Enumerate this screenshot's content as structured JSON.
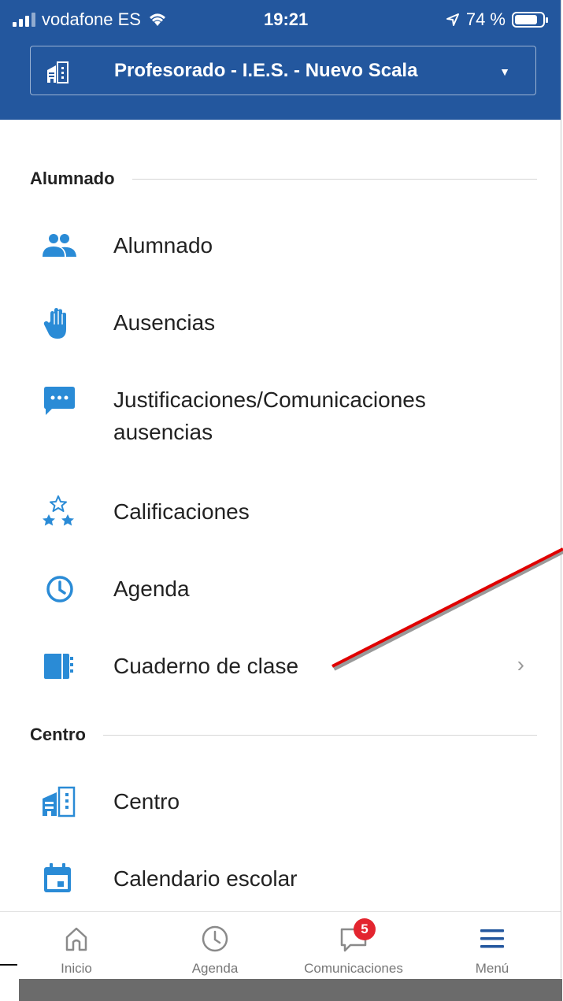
{
  "status_bar": {
    "carrier": "vodafone ES",
    "time": "19:21",
    "battery": "74 %",
    "battery_level": 0.74
  },
  "header": {
    "selector_label": "Profesorado - I.E.S. - Nuevo Scala"
  },
  "sections": {
    "alumnado": "Alumnado",
    "centro": "Centro"
  },
  "items": [
    {
      "label": "Alumnado",
      "icon": "users-icon"
    },
    {
      "label": "Ausencias",
      "icon": "hand-icon"
    },
    {
      "label": "Justificaciones/Comunicaciones",
      "label2": "ausencias",
      "icon": "chat-bubble-icon"
    },
    {
      "label": "Calificaciones",
      "icon": "stars-icon"
    },
    {
      "label": "Agenda",
      "icon": "clock-icon"
    },
    {
      "label": "Cuaderno de clase",
      "icon": "notebook-icon",
      "chevron": "›"
    },
    {
      "label": "Centro",
      "icon": "building-icon"
    },
    {
      "label": "Calendario escolar",
      "icon": "calendar-icon"
    }
  ],
  "tabbar": {
    "tabs": [
      {
        "label": "Inicio",
        "icon": "home-icon"
      },
      {
        "label": "Agenda",
        "icon": "clock-icon"
      },
      {
        "label": "Comunicaciones",
        "icon": "chat-icon",
        "badge": "5"
      },
      {
        "label": "Menú",
        "icon": "menu-icon"
      }
    ]
  },
  "colors": {
    "header": "#23579e",
    "icon": "#2a8bd6",
    "annotation": "#e00000"
  }
}
